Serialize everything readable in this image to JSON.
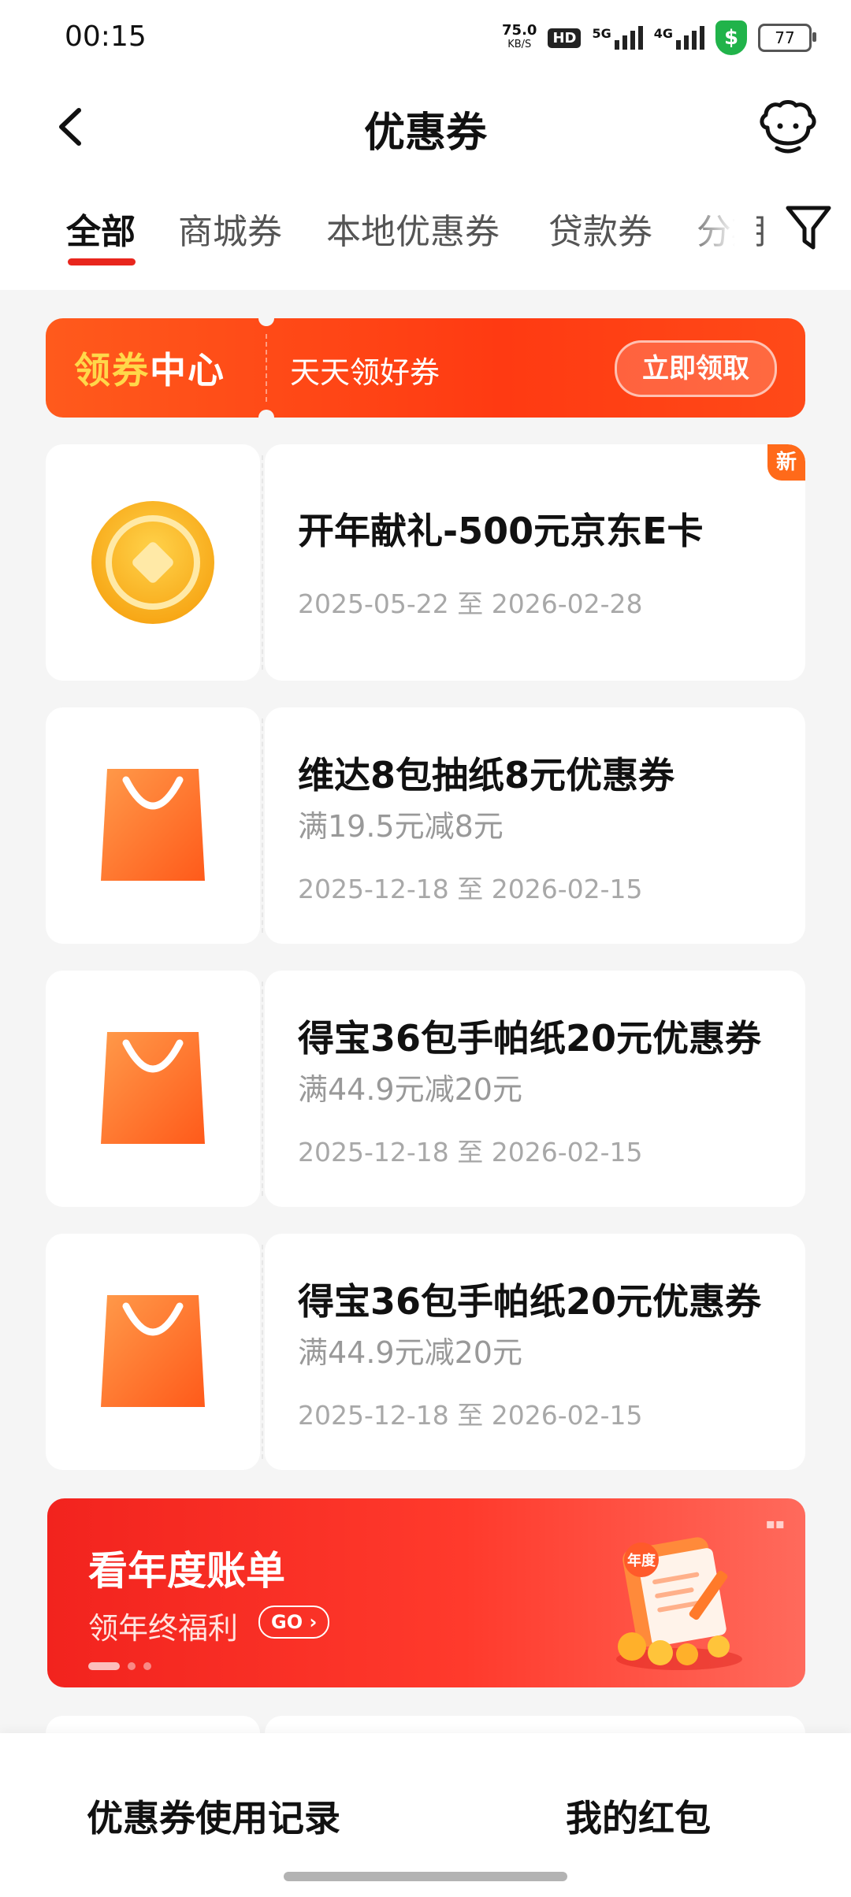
{
  "status_bar": {
    "time": "00:15",
    "speed_value": "75.0",
    "speed_unit": "KB/S",
    "hd": "HD",
    "sig1": "5G",
    "sig2": "4G",
    "shield_symbol": "$",
    "battery": "77"
  },
  "header": {
    "title": "优惠券"
  },
  "tabs": [
    {
      "label": "全部",
      "active": true
    },
    {
      "label": "商城券"
    },
    {
      "label": "本地优惠券"
    },
    {
      "label": "贷款券"
    },
    {
      "label": "分期"
    }
  ],
  "coupon_center": {
    "title_part1": "领券",
    "title_part2": "中心",
    "subtitle": "天天领好券",
    "button": "立即领取"
  },
  "coupons": [
    {
      "title": "开年献礼-500元京东E卡",
      "condition": "",
      "date": "2025-05-22 至 2026-02-28",
      "badge": "新",
      "icon": "coin-icon"
    },
    {
      "title": "维达8包抽纸8元优惠券",
      "condition": "满19.5元减8元",
      "date": "2025-12-18 至 2026-02-15",
      "icon": "shopping-bag-icon"
    },
    {
      "title": "得宝36包手帕纸20元优惠券",
      "condition": "满44.9元减20元",
      "date": "2025-12-18 至 2026-02-15",
      "icon": "shopping-bag-icon"
    },
    {
      "title": "得宝36包手帕纸20元优惠券",
      "condition": "满44.9元减20元",
      "date": "2025-12-18 至 2026-02-15",
      "icon": "shopping-bag-icon"
    }
  ],
  "bill_banner": {
    "title": "看年度账单",
    "subtitle": "领年终福利",
    "go": "GO",
    "badge": "年度"
  },
  "bottom_bar": {
    "records": "优惠券使用记录",
    "red_packets": "我的红包"
  },
  "colors": {
    "accent": "#e8261d",
    "banner_orange": "#ff4a18",
    "banner_red": "#f2231e",
    "gold": "#ffd84a"
  }
}
